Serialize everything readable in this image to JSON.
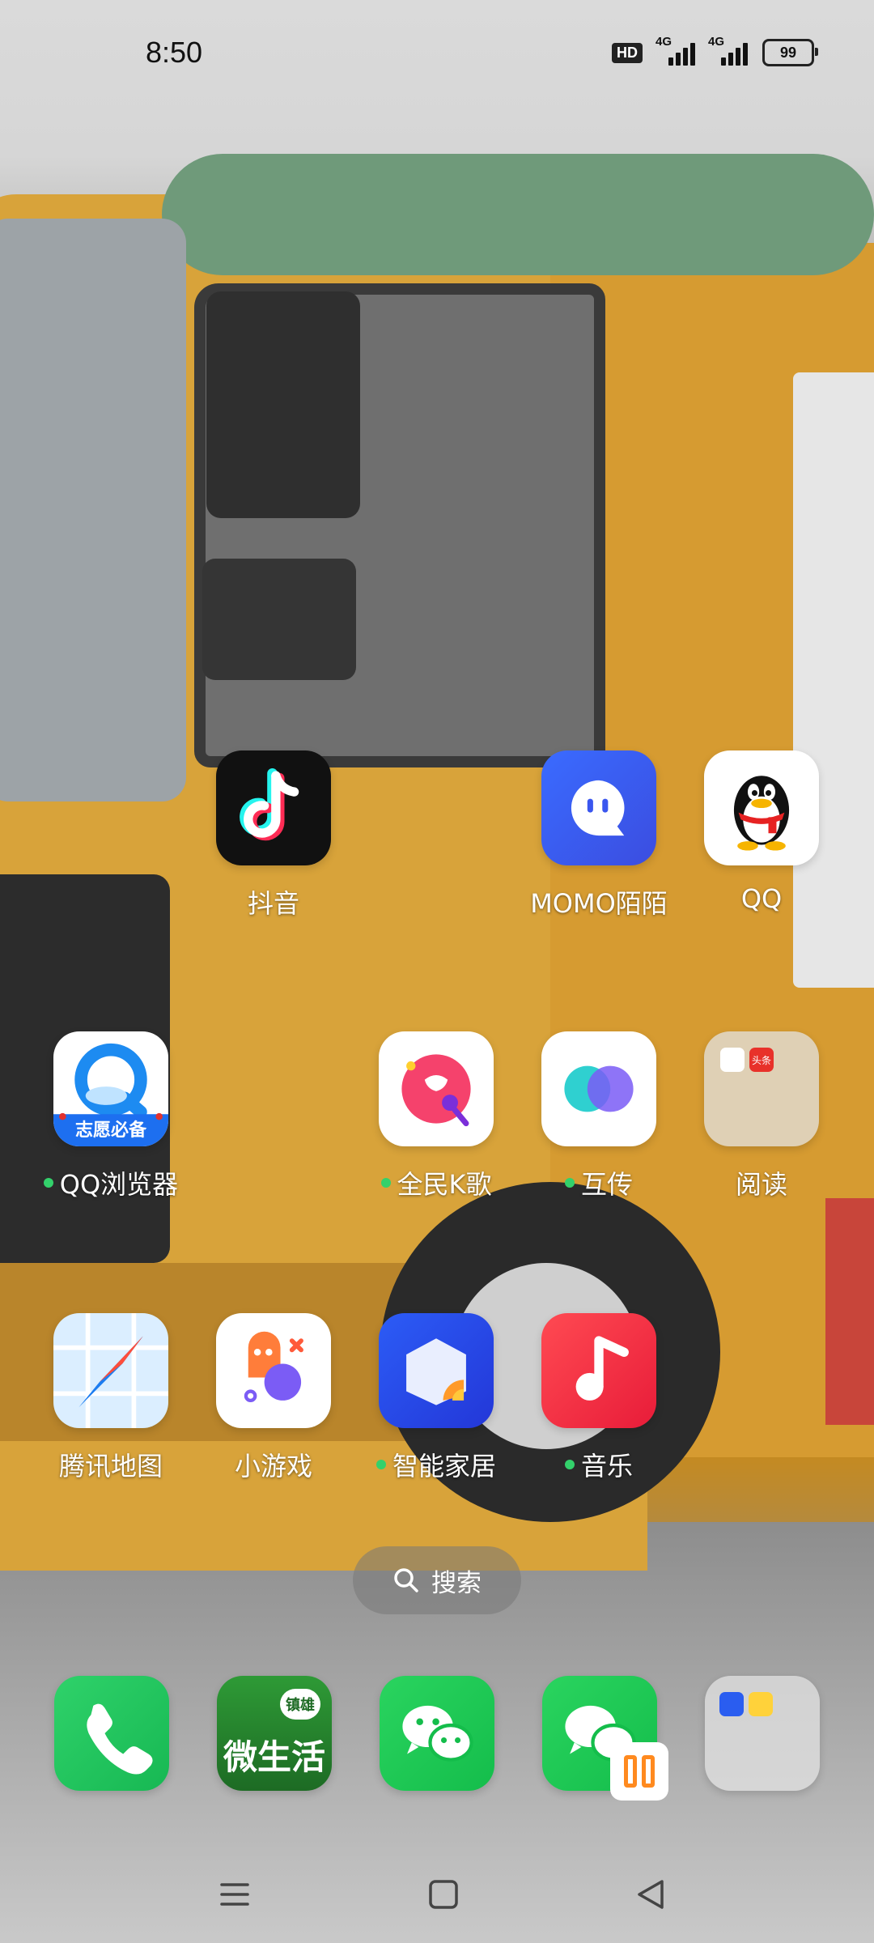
{
  "status_bar": {
    "time": "8:50",
    "hd_badge": "HD",
    "sim1_network": "4G",
    "sim2_network": "4G",
    "battery": "99"
  },
  "apps": [
    {
      "name": "douyin",
      "label": "抖音",
      "dot": false
    },
    {
      "name": "momo",
      "label": "MOMO陌陌",
      "dot": false
    },
    {
      "name": "qq",
      "label": "QQ",
      "dot": false
    },
    {
      "name": "qq-browser",
      "label": "QQ浏览器",
      "dot": true
    },
    {
      "name": "quanmin-kge",
      "label": "全民K歌",
      "dot": true
    },
    {
      "name": "huchuan",
      "label": "互传",
      "dot": true
    },
    {
      "name": "reading-folder",
      "label": "阅读",
      "dot": false
    },
    {
      "name": "tencent-map",
      "label": "腾讯地图",
      "dot": false
    },
    {
      "name": "mini-games",
      "label": "小游戏",
      "dot": false
    },
    {
      "name": "smart-home",
      "label": "智能家居",
      "dot": true
    },
    {
      "name": "music",
      "label": "音乐",
      "dot": true
    }
  ],
  "icon_text": {
    "qq_browser_banner": "志愿必备",
    "wechat_life_main": "微生活",
    "wechat_life_badge": "镇雄",
    "toutiao_mini": "头条"
  },
  "search": {
    "label": "搜索"
  },
  "dock": [
    {
      "name": "phone"
    },
    {
      "name": "zhenxiong-wechat-life"
    },
    {
      "name": "wechat"
    },
    {
      "name": "wechat-clone"
    },
    {
      "name": "folder"
    }
  ],
  "colors": {
    "dot_green": "#33d16b",
    "wechat_green": "#1fd35f",
    "music_red": "#f03240"
  }
}
